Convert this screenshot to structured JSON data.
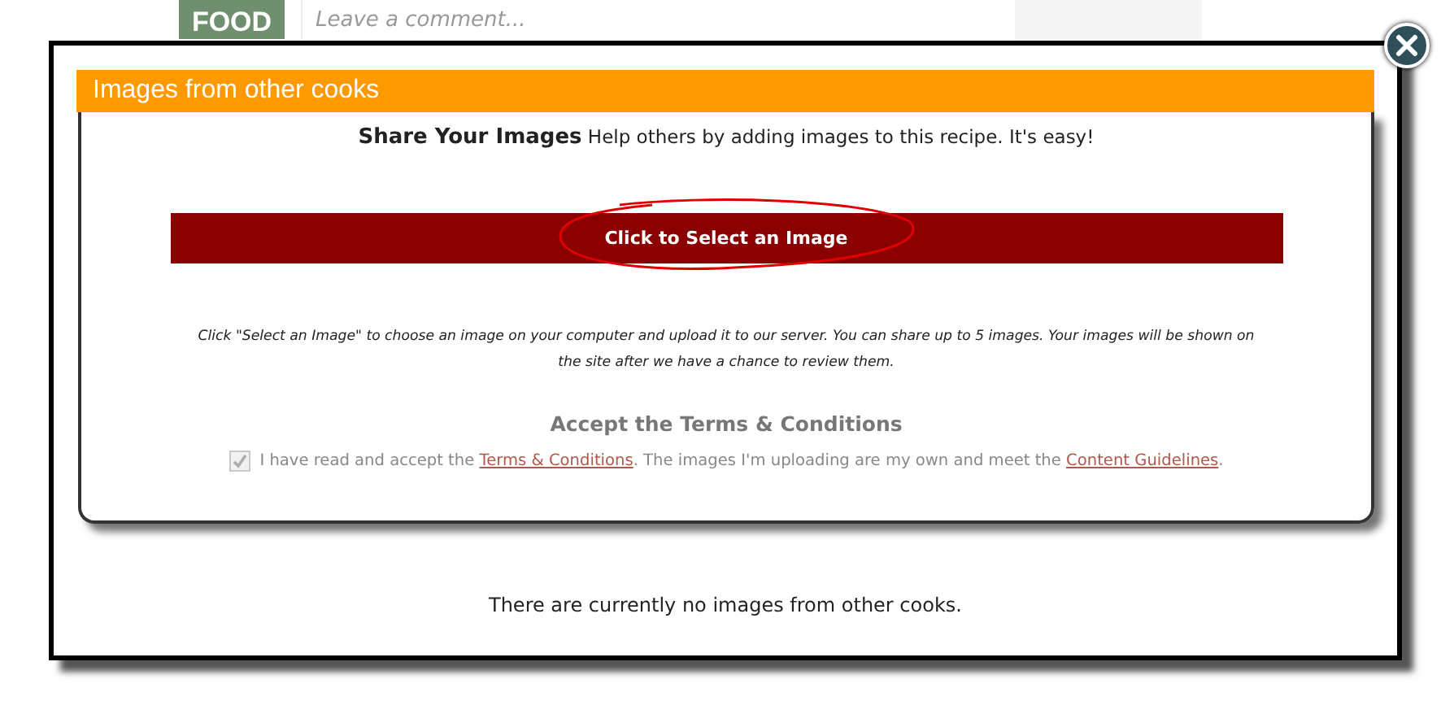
{
  "background": {
    "logo": "FOOD",
    "comment_field": {
      "placeholder": "Leave a comment..."
    }
  },
  "dialog": {
    "title": "Images from other cooks",
    "intro": {
      "heading": "Share Your Images",
      "text": "Help others by adding images to this recipe. It's easy!"
    },
    "select_button": {
      "label": "Click to Select an Image",
      "circled": true
    },
    "instructions": "Click \"Select an Image\" to choose an image on your computer and upload it to our server. You can share up to 5 images. Your images will be shown on the site after we have a chance to review them.",
    "terms": {
      "heading": "Accept the Terms & Conditions",
      "checked": true,
      "disabled": true,
      "text_1": "I have read and accept the",
      "link_1": "Terms & Conditions",
      "text_2": ". The images I'm uploading are my own and meet the",
      "link_2": "Content Guidelines",
      "text_3": "."
    },
    "empty_message": "There are currently no images from other cooks."
  }
}
